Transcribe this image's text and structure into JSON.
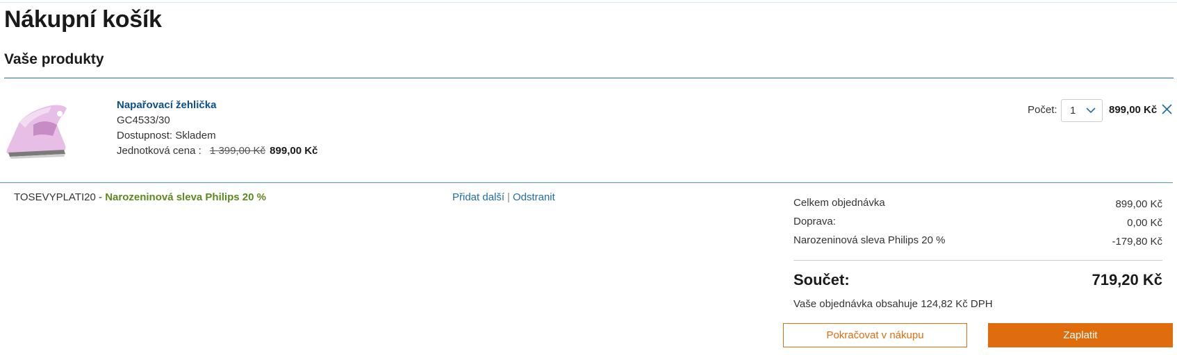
{
  "page": {
    "title": "Nákupní košík",
    "section_title": "Vaše produkty"
  },
  "product": {
    "name": "Napařovací žehlička",
    "model": "GC4533/30",
    "availability": "Dostupnost: Skladem",
    "unit_price_label": "Jednotková cena :",
    "unit_price_old": "1 399,00 Kč",
    "unit_price_new": "899,00 Kč",
    "quantity_label": "Počet:",
    "quantity_value": "1",
    "line_total": "899,00 Kč",
    "image_icon": "steam-iron-image"
  },
  "coupon": {
    "code": "TOSEVYPLATI20",
    "separator": " - ",
    "description": "Narozeninová sleva Philips 20 %",
    "add_more_label": "Přidat další",
    "divider": "|",
    "remove_label": "Odstranit"
  },
  "summary": {
    "rows": [
      {
        "label": "Celkem objednávka",
        "value": "899,00 Kč"
      },
      {
        "label": "Doprava:",
        "value": "0,00 Kč"
      },
      {
        "label": "Narozeninová sleva Philips 20 %",
        "value": "-179,80 Kč"
      }
    ],
    "total_label": "Součet:",
    "total_value": "719,20 Kč",
    "vat_note": "Vaše objednávka obsahuje 124,82 Kč DPH"
  },
  "actions": {
    "continue_label": "Pokračovat v nákupu",
    "pay_label": "Zaplatit"
  },
  "colors": {
    "accent_orange": "#e06d0d",
    "link_blue": "#1e6fa6",
    "coupon_green": "#5b8a1f",
    "product_name_blue": "#0b4f8a"
  }
}
